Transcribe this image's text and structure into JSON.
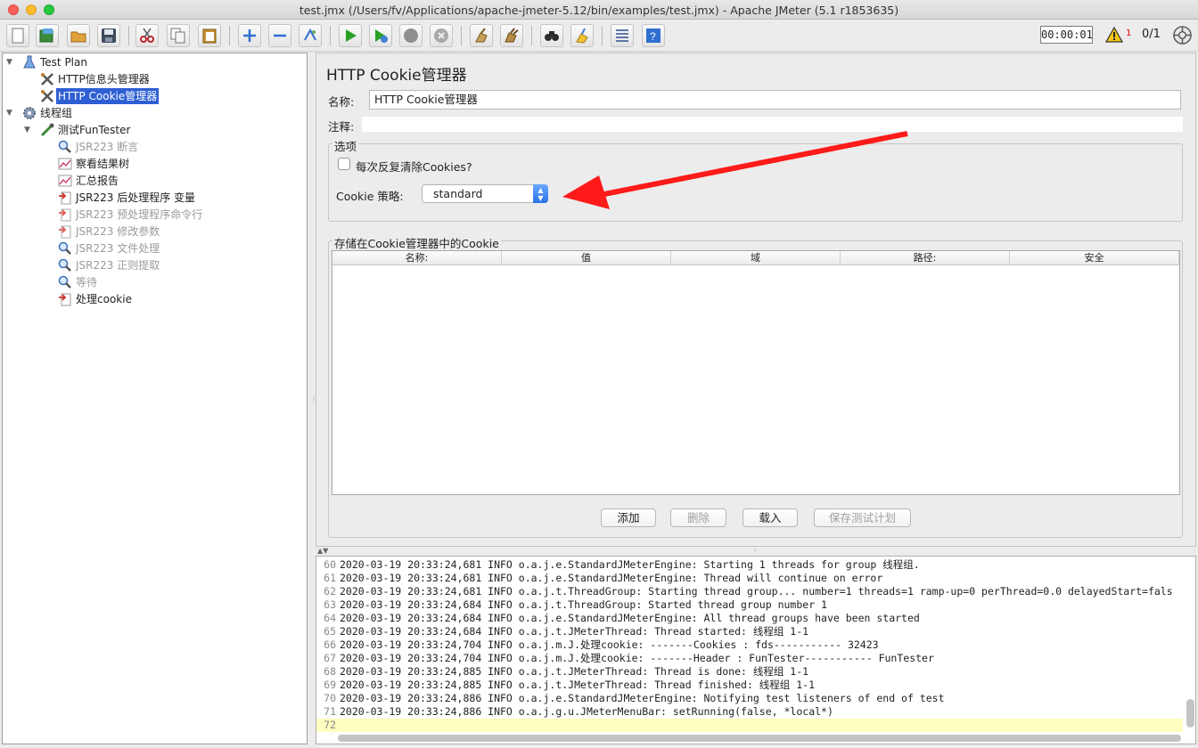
{
  "window": {
    "title": "test.jmx (/Users/fv/Applications/apache-jmeter-5.12/bin/examples/test.jmx) - Apache JMeter (5.1 r1853635)"
  },
  "toolbar": {
    "buttons": [
      "new-icon",
      "templates-icon",
      "open-icon",
      "save-icon",
      "cut-icon",
      "copy-icon",
      "paste-icon",
      "expand-icon",
      "collapse-icon",
      "toggle-icon",
      "start-icon",
      "start-no-pause-icon",
      "stop-icon",
      "shutdown-icon",
      "clear-icon",
      "clear-all-icon",
      "search-icon",
      "reset-search-icon",
      "function-helper-icon",
      "help-icon"
    ],
    "timer": "00:00:01",
    "warning_count": "1",
    "thread_count": "0/1"
  },
  "tree": {
    "items": [
      {
        "label": "Test Plan",
        "icon": "test-plan-icon",
        "disabled": false,
        "selected": false,
        "expanded": true
      },
      {
        "label": "HTTP信息头管理器",
        "icon": "config-tools-icon",
        "disabled": false,
        "selected": false
      },
      {
        "label": "HTTP Cookie管理器",
        "icon": "config-tools-icon",
        "disabled": false,
        "selected": true
      },
      {
        "label": "线程组",
        "icon": "thread-group-gear-icon",
        "disabled": false,
        "selected": false,
        "expanded": true
      },
      {
        "label": "测试FunTester",
        "icon": "sampler-pipette-icon",
        "disabled": false,
        "selected": false,
        "expanded": true
      },
      {
        "label": "JSR223 断言",
        "icon": "assertion-magnifier-icon",
        "disabled": true,
        "selected": false
      },
      {
        "label": "察看结果树",
        "icon": "listener-graph-icon",
        "disabled": false,
        "selected": false
      },
      {
        "label": "汇总报告",
        "icon": "listener-graph-icon",
        "disabled": false,
        "selected": false
      },
      {
        "label": "JSR223 后处理程序 变量",
        "icon": "post-processor-icon",
        "disabled": false,
        "selected": false
      },
      {
        "label": "JSR223 预处理程序命令行",
        "icon": "pre-processor-icon",
        "disabled": true,
        "selected": false
      },
      {
        "label": "JSR223 修改参数",
        "icon": "pre-processor-icon",
        "disabled": true,
        "selected": false
      },
      {
        "label": "JSR223 文件处理",
        "icon": "assertion-magnifier-icon",
        "disabled": true,
        "selected": false
      },
      {
        "label": "JSR223 正则提取",
        "icon": "assertion-magnifier-icon",
        "disabled": true,
        "selected": false
      },
      {
        "label": "等待",
        "icon": "assertion-magnifier-icon",
        "disabled": true,
        "selected": false
      },
      {
        "label": "处理cookie",
        "icon": "post-processor-icon",
        "disabled": false,
        "selected": false
      }
    ]
  },
  "panel": {
    "title": "HTTP Cookie管理器",
    "name_label": "名称:",
    "name_value": "HTTP Cookie管理器",
    "comment_label": "注释:",
    "comment_value": "",
    "options_legend": "选项",
    "clear_each_iteration_label": "每次反复清除Cookies?",
    "clear_each_iteration_checked": false,
    "policy_label": "Cookie 策略:",
    "policy_value": "standard",
    "stored_legend": "存储在Cookie管理器中的Cookie",
    "table_columns": [
      "名称:",
      "值",
      "域",
      "路径:",
      "安全"
    ],
    "buttons": {
      "add": "添加",
      "delete": "删除",
      "load": "载入",
      "save": "保存测试计划"
    }
  },
  "annotation": {
    "color": "#ff1a1a"
  },
  "log": {
    "lines": [
      {
        "num": "60",
        "text": "2020-03-19 20:33:24,681 INFO o.a.j.e.StandardJMeterEngine: Starting 1 threads for group 线程组."
      },
      {
        "num": "61",
        "text": "2020-03-19 20:33:24,681 INFO o.a.j.e.StandardJMeterEngine: Thread will continue on error"
      },
      {
        "num": "62",
        "text": "2020-03-19 20:33:24,681 INFO o.a.j.t.ThreadGroup: Starting thread group... number=1 threads=1 ramp-up=0 perThread=0.0 delayedStart=fals"
      },
      {
        "num": "63",
        "text": "2020-03-19 20:33:24,684 INFO o.a.j.t.ThreadGroup: Started thread group number 1"
      },
      {
        "num": "64",
        "text": "2020-03-19 20:33:24,684 INFO o.a.j.e.StandardJMeterEngine: All thread groups have been started"
      },
      {
        "num": "65",
        "text": "2020-03-19 20:33:24,684 INFO o.a.j.t.JMeterThread: Thread started: 线程组 1-1"
      },
      {
        "num": "66",
        "text": "2020-03-19 20:33:24,704 INFO o.a.j.m.J.处理cookie: -------Cookies : fds----------- 32423"
      },
      {
        "num": "67",
        "text": "2020-03-19 20:33:24,704 INFO o.a.j.m.J.处理cookie: -------Header : FunTester----------- FunTester"
      },
      {
        "num": "68",
        "text": "2020-03-19 20:33:24,885 INFO o.a.j.t.JMeterThread: Thread is done: 线程组 1-1"
      },
      {
        "num": "69",
        "text": "2020-03-19 20:33:24,885 INFO o.a.j.t.JMeterThread: Thread finished: 线程组 1-1"
      },
      {
        "num": "70",
        "text": "2020-03-19 20:33:24,886 INFO o.a.j.e.StandardJMeterEngine: Notifying test listeners of end of test"
      },
      {
        "num": "71",
        "text": "2020-03-19 20:33:24,886 INFO o.a.j.g.u.JMeterMenuBar: setRunning(false, *local*)"
      },
      {
        "num": "72",
        "text": ""
      }
    ]
  }
}
